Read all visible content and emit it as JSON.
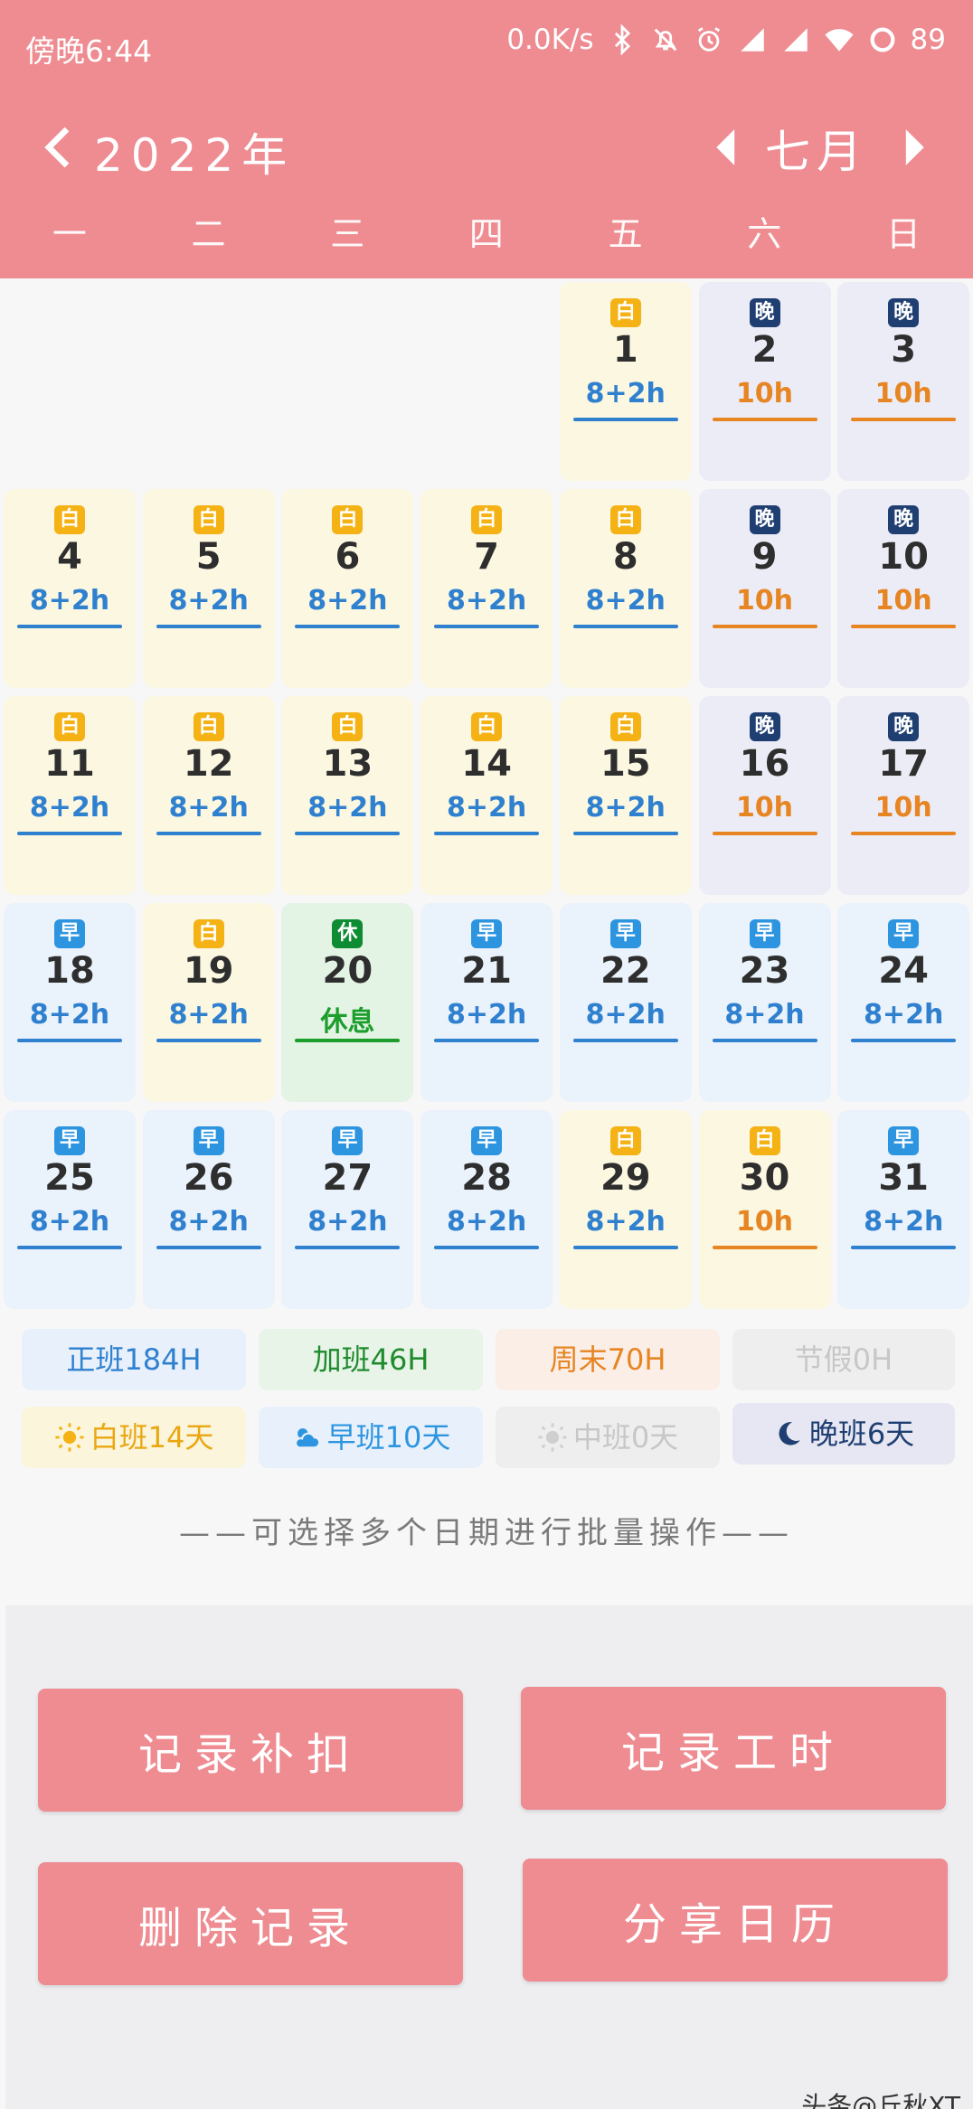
{
  "status_bar": {
    "time": "傍晚6:44",
    "network_speed": "0.0K/s",
    "battery": "89",
    "icons": [
      "bluetooth-icon",
      "mute-icon",
      "alarm-icon",
      "hd-signal-icon",
      "signal-icon",
      "wifi-icon",
      "battery-icon"
    ]
  },
  "header": {
    "year": "2022年",
    "month": "七月",
    "weekdays": [
      "一",
      "二",
      "三",
      "四",
      "五",
      "六",
      "日"
    ]
  },
  "colors": {
    "header_bg": "#ee8c92",
    "day_shift": "#f5b214",
    "night_shift": "#1f3f72",
    "early_shift": "#2d95e0",
    "rest": "#0d8c33",
    "hours_blue": "#2f80cf",
    "hours_orange": "#e68522"
  },
  "calendar": {
    "days": [
      {
        "day": "1",
        "badge": "白",
        "type": "day",
        "hours": "8+2h"
      },
      {
        "day": "2",
        "badge": "晚",
        "type": "night",
        "hours": "10h"
      },
      {
        "day": "3",
        "badge": "晚",
        "type": "night",
        "hours": "10h"
      },
      {
        "day": "4",
        "badge": "白",
        "type": "day",
        "hours": "8+2h"
      },
      {
        "day": "5",
        "badge": "白",
        "type": "day",
        "hours": "8+2h"
      },
      {
        "day": "6",
        "badge": "白",
        "type": "day",
        "hours": "8+2h"
      },
      {
        "day": "7",
        "badge": "白",
        "type": "day",
        "hours": "8+2h"
      },
      {
        "day": "8",
        "badge": "白",
        "type": "day",
        "hours": "8+2h"
      },
      {
        "day": "9",
        "badge": "晚",
        "type": "night",
        "hours": "10h"
      },
      {
        "day": "10",
        "badge": "晚",
        "type": "night",
        "hours": "10h"
      },
      {
        "day": "11",
        "badge": "白",
        "type": "day",
        "hours": "8+2h"
      },
      {
        "day": "12",
        "badge": "白",
        "type": "day",
        "hours": "8+2h"
      },
      {
        "day": "13",
        "badge": "白",
        "type": "day",
        "hours": "8+2h"
      },
      {
        "day": "14",
        "badge": "白",
        "type": "day",
        "hours": "8+2h"
      },
      {
        "day": "15",
        "badge": "白",
        "type": "day",
        "hours": "8+2h"
      },
      {
        "day": "16",
        "badge": "晚",
        "type": "night",
        "hours": "10h"
      },
      {
        "day": "17",
        "badge": "晚",
        "type": "night",
        "hours": "10h"
      },
      {
        "day": "18",
        "badge": "早",
        "type": "early",
        "hours": "8+2h"
      },
      {
        "day": "19",
        "badge": "白",
        "type": "day",
        "hours": "8+2h"
      },
      {
        "day": "20",
        "badge": "休",
        "type": "rest",
        "hours": "休息"
      },
      {
        "day": "21",
        "badge": "早",
        "type": "early",
        "hours": "8+2h"
      },
      {
        "day": "22",
        "badge": "早",
        "type": "early",
        "hours": "8+2h"
      },
      {
        "day": "23",
        "badge": "早",
        "type": "early",
        "hours": "8+2h"
      },
      {
        "day": "24",
        "badge": "早",
        "type": "early",
        "hours": "8+2h"
      },
      {
        "day": "25",
        "badge": "早",
        "type": "early",
        "hours": "8+2h"
      },
      {
        "day": "26",
        "badge": "早",
        "type": "early",
        "hours": "8+2h"
      },
      {
        "day": "27",
        "badge": "早",
        "type": "early",
        "hours": "8+2h"
      },
      {
        "day": "28",
        "badge": "早",
        "type": "early",
        "hours": "8+2h"
      },
      {
        "day": "29",
        "badge": "白",
        "type": "day",
        "hours": "8+2h"
      },
      {
        "day": "30",
        "badge": "白",
        "type": "day",
        "hours": "10h",
        "hours_color": "orange"
      },
      {
        "day": "31",
        "badge": "早",
        "type": "early",
        "hours": "8+2h"
      }
    ]
  },
  "stats": {
    "regular": "正班184H",
    "overtime": "加班46H",
    "weekend": "周末70H",
    "holiday": "节假0H",
    "day_shift": "白班14天",
    "early_shift": "早班10天",
    "mid_shift": "中班0天",
    "night_shift": "晚班6天"
  },
  "hint": "——可选择多个日期进行批量操作——",
  "actions": {
    "record_deduction": "记录补扣",
    "record_hours": "记录工时",
    "delete_record": "删除记录",
    "share_calendar": "分享日历"
  },
  "watermark": "头条@丘秋XT"
}
